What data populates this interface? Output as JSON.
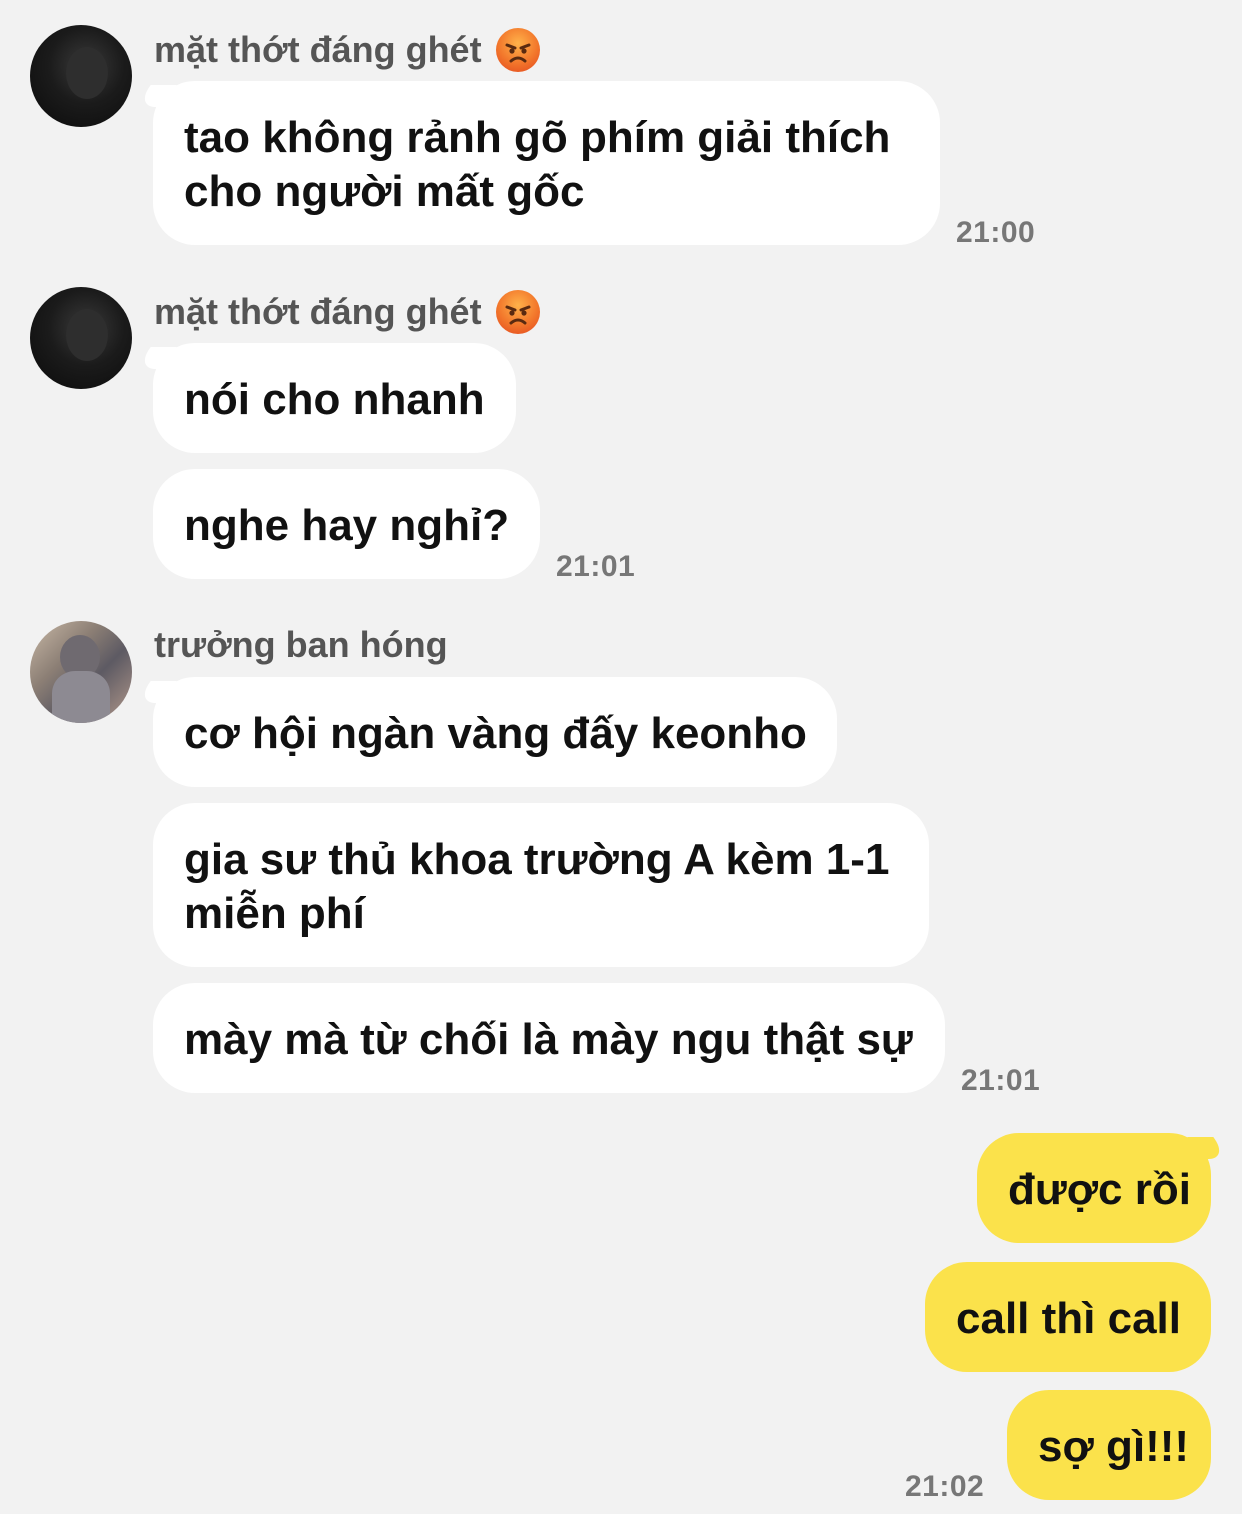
{
  "groups": [
    {
      "sender": "mặt thớt đáng ghét",
      "sender_emoji": "angry-face-emoji",
      "avatar": "dark-profile-photo",
      "messages": [
        "tao không rảnh gõ phím giải thích\ncho người mất gốc"
      ],
      "time": "21:00"
    },
    {
      "sender": "mặt thớt đáng ghét",
      "sender_emoji": "angry-face-emoji",
      "avatar": "dark-profile-photo",
      "messages": [
        "nói cho nhanh",
        "nghe hay nghỉ?"
      ],
      "time": "21:01"
    },
    {
      "sender": "trưởng ban hóng",
      "avatar": "profile-photo",
      "messages": [
        "cơ hội ngàn vàng đấy keonho",
        "gia sư thủ khoa trường A kèm 1-1\nmiễn phí",
        "mày mà từ chối là mày ngu thật sự"
      ],
      "time": "21:01"
    }
  ],
  "my_messages": {
    "messages": [
      "được rồi",
      "call thì call",
      "sợ gì!!!"
    ],
    "time": "21:02"
  },
  "colors": {
    "background": "#f2f2f2",
    "incoming_bubble": "#ffffff",
    "outgoing_bubble": "#fbe24b"
  }
}
